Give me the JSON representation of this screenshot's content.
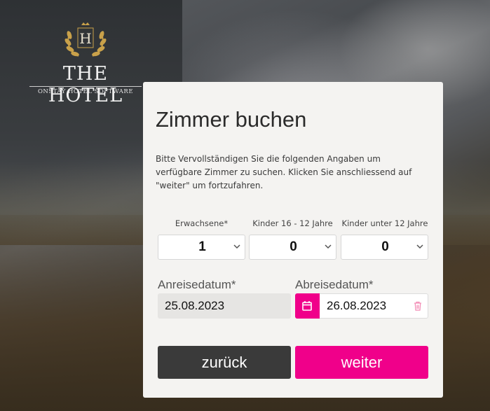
{
  "brand": {
    "initial": "H",
    "name": "THE HOTEL",
    "tagline": "ONSTAY HOTEL SOFTWARE"
  },
  "form": {
    "title": "Zimmer buchen",
    "description": "Bitte Vervollständigen Sie die folgenden Angaben um verfügbare Zimmer zu suchen. Klicken Sie anschliessend auf \"weiter\" um fortzufahren.",
    "guests": [
      {
        "label": "Erwachsene*",
        "value": "1"
      },
      {
        "label": "Kinder 16 - 12 Jahre",
        "value": "0"
      },
      {
        "label": "Kinder unter 12 Jahre",
        "value": "0"
      }
    ],
    "arrival": {
      "label": "Anreisedatum*",
      "value": "25.08.2023"
    },
    "departure": {
      "label": "Abreisedatum*",
      "value": "26.08.2023"
    },
    "back_label": "zurück",
    "next_label": "weiter"
  },
  "colors": {
    "accent": "#f0008a",
    "dark_button": "#3a3a3a",
    "card_bg": "#f4f3f1",
    "logo_gold": "#c9a14a"
  },
  "icons": {
    "calendar": "calendar-icon",
    "trash": "trash-icon",
    "chevron": "chevron-down-icon",
    "laurel": "laurel-wreath-icon"
  }
}
